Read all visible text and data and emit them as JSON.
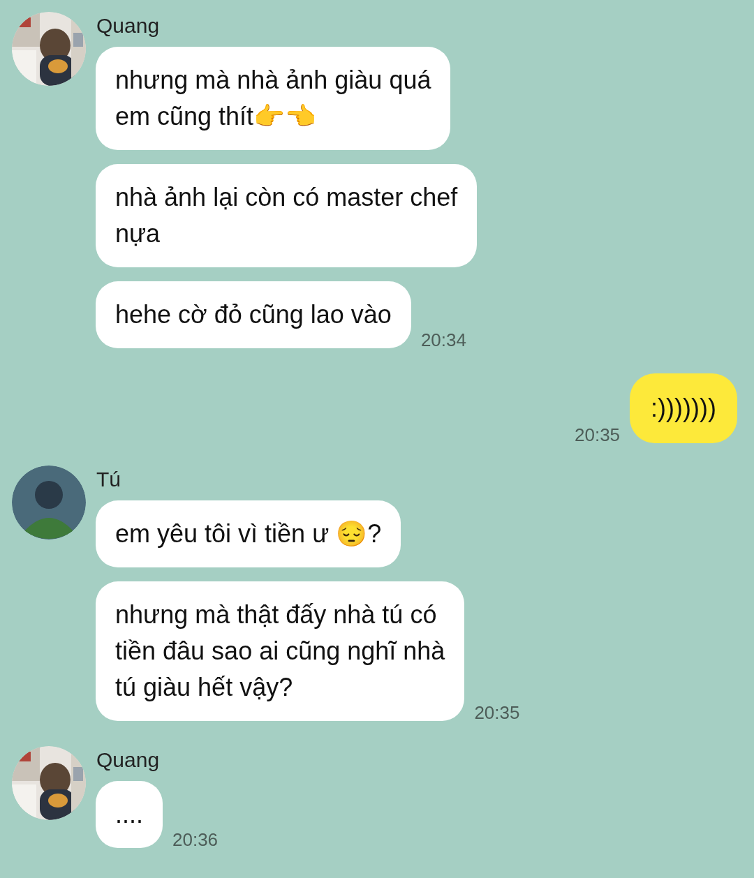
{
  "messages": [
    {
      "kind": "received",
      "sender": "Quang",
      "avatar": {
        "kind": "picture"
      },
      "bubbles": [
        {
          "text": "nhưng mà nhà ảnh giàu quá\nem cũng thít👉👈"
        },
        {
          "text": "nhà ảnh lại còn có master chef\nnựa"
        },
        {
          "text": "hehe cờ đỏ cũng lao vào",
          "time": "20:34"
        }
      ]
    },
    {
      "kind": "sent",
      "bubbles": [
        {
          "text": ":)))))))",
          "time": "20:35"
        }
      ]
    },
    {
      "kind": "received",
      "sender": "Tú",
      "avatar": {
        "kind": "silhouette"
      },
      "bubbles": [
        {
          "text": "em yêu tôi vì tiền ư 😔?"
        },
        {
          "text": "nhưng mà thật đấy nhà tú có\ntiền đâu sao ai cũng nghĩ nhà\ntú giàu hết vậy?",
          "time": "20:35"
        }
      ]
    },
    {
      "kind": "received",
      "sender": "Quang",
      "avatar": {
        "kind": "picture"
      },
      "bubbles": [
        {
          "text": "....",
          "time": "20:36"
        }
      ]
    }
  ]
}
